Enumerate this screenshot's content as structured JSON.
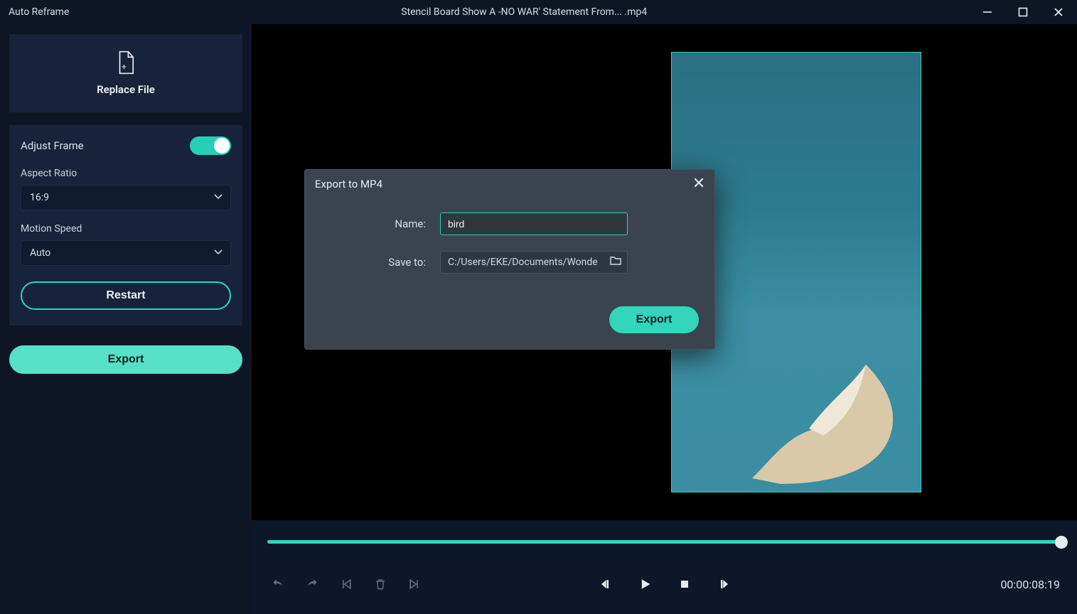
{
  "titlebar": {
    "app_title": "Auto Reframe",
    "file_title": "Stencil Board Show A -NO WAR' Statement From... .mp4"
  },
  "sidebar": {
    "replace_file_label": "Replace File",
    "adjust_frame_label": "Adjust Frame",
    "adjust_frame_on": true,
    "aspect_ratio_label": "Aspect Ratio",
    "aspect_ratio_value": "16:9",
    "motion_speed_label": "Motion Speed",
    "motion_speed_value": "Auto",
    "restart_label": "Restart",
    "export_label": "Export"
  },
  "controls": {
    "timecode": "00:00:08:19"
  },
  "modal": {
    "title": "Export to MP4",
    "name_label": "Name:",
    "name_value": "bird",
    "saveto_label": "Save to:",
    "saveto_value": "C:/Users/EKE/Documents/Wonde",
    "export_label": "Export"
  }
}
